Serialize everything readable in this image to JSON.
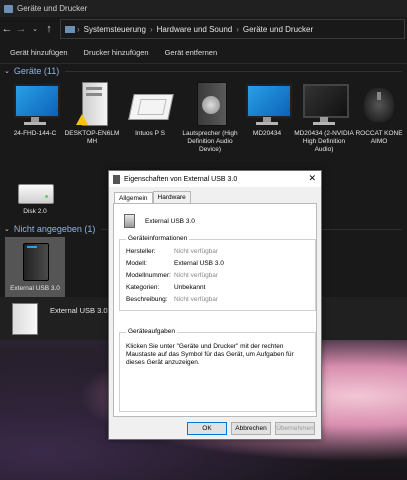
{
  "window": {
    "title": "Geräte und Drucker"
  },
  "address": {
    "segments": [
      "Systemsteuerung",
      "Hardware und Sound",
      "Geräte und Drucker"
    ]
  },
  "toolbar": {
    "add_device": "Gerät hinzufügen",
    "add_printer": "Drucker hinzufügen",
    "remove_device": "Gerät entfernen"
  },
  "groups": {
    "devices": "Geräte (11)",
    "unspecified": "Nicht angegeben (1)"
  },
  "devices": [
    {
      "label": "24-FHD-144-C",
      "icon": "monitor-icon"
    },
    {
      "label": "DESKTOP-EN6LM MH",
      "icon": "pc-tower-icon"
    },
    {
      "label": "Intuos P S",
      "icon": "tablet-icon"
    },
    {
      "label": "Lautsprecher (High Definition Audio Device)",
      "icon": "speaker-icon"
    },
    {
      "label": "MD20434",
      "icon": "monitor-icon"
    },
    {
      "label": "MD20434 (2-NVIDIA High Definition Audio)",
      "icon": "monitor-icon"
    },
    {
      "label": "ROCCAT KONE AIMO",
      "icon": "mouse-icon"
    },
    {
      "label": "Disk 2.0",
      "icon": "drive-icon"
    }
  ],
  "unspecified_devices": [
    {
      "label": "External USB 3.0",
      "icon": "usb-drive-icon"
    }
  ],
  "bottom_pane": {
    "name": "External USB 3.0"
  },
  "dialog": {
    "title": "Eigenschaften von External USB 3.0",
    "close": "✕",
    "tabs": [
      "Allgemein",
      "Hardware"
    ],
    "device_name": "External USB 3.0",
    "info_legend": "Geräteinformationen",
    "info": {
      "manufacturer_key": "Hersteller:",
      "manufacturer_val": "Nicht verfügbar",
      "model_key": "Modell:",
      "model_val": "External USB 3.0",
      "modelnr_key": "Modellnummer:",
      "modelnr_val": "Nicht verfügbar",
      "category_key": "Kategorien:",
      "category_val": "Unbekannt",
      "desc_key": "Beschreibung:",
      "desc_val": "Nicht verfügbar"
    },
    "tasks_legend": "Geräteaufgaben",
    "tasks_text": "Klicken Sie unter \"Geräte und Drucker\" mit der rechten Maustaste auf das Symbol für das Gerät, um Aufgaben für dieses Gerät anzuzeigen.",
    "ok": "OK",
    "cancel": "Abbrechen",
    "apply": "Übernehmen"
  },
  "colors": {
    "group_header": "#8fb4e3",
    "explorer_bg": "#191919",
    "accent": "#0078d7"
  }
}
